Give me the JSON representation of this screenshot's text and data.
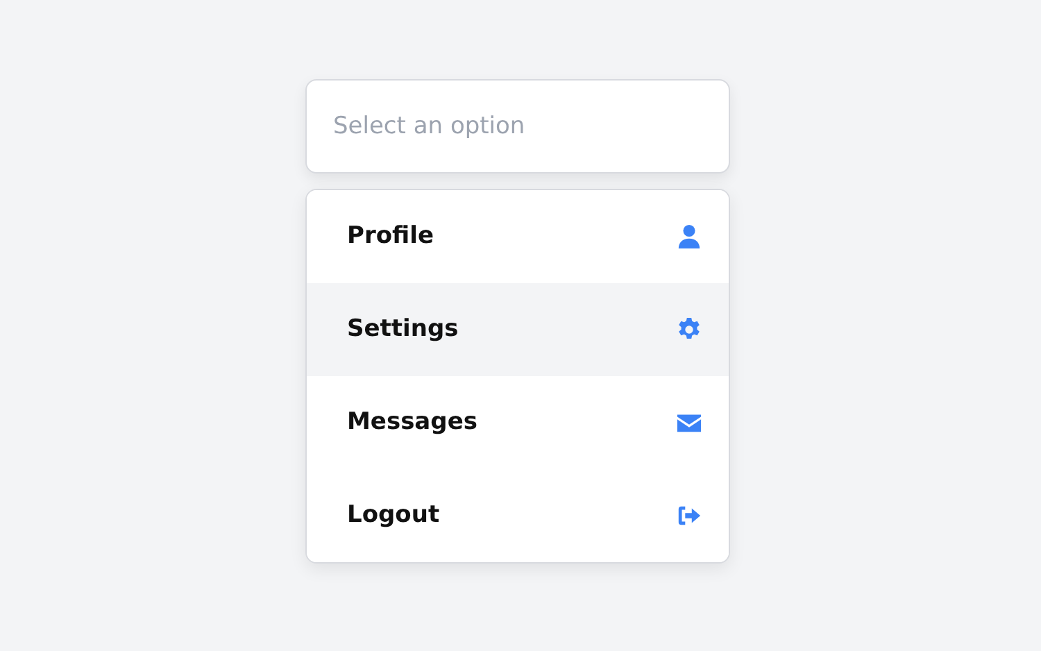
{
  "select": {
    "placeholder": "Select an option"
  },
  "options": [
    {
      "label": "Profile",
      "selected": false
    },
    {
      "label": "Settings",
      "selected": true
    },
    {
      "label": "Messages",
      "selected": false
    },
    {
      "label": "Logout",
      "selected": false
    }
  ]
}
